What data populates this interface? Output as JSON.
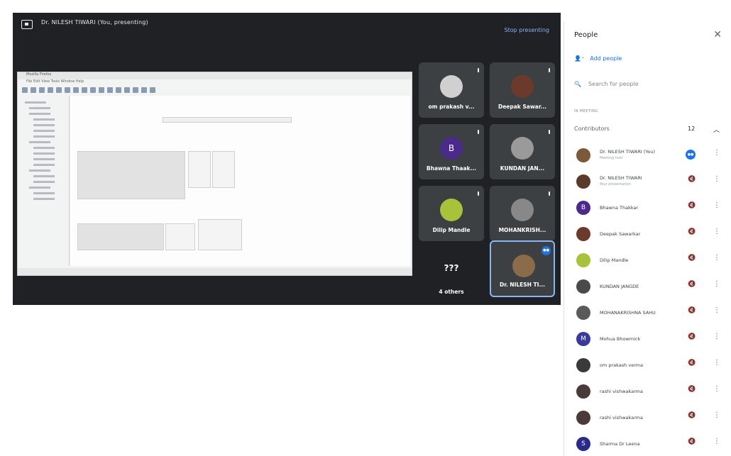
{
  "stage": {
    "presenting_label": "Dr. NILESH TIWARI (You, presenting)",
    "stop_presenting": "Stop presenting",
    "shared_doc": {
      "title": "Mozilla Firefox",
      "menu": "File  Edit  View  Tools  Window  Help"
    }
  },
  "tiles": [
    {
      "name": "om prakash v...",
      "avatar_color": "#d0d0d0"
    },
    {
      "name": "Deepak Sawar...",
      "avatar_color": "#6b3a2a"
    },
    {
      "name": "Bhawna Thaak...",
      "avatar_color": "#4a2a8a",
      "initial": "B"
    },
    {
      "name": "KUNDAN JAN...",
      "avatar_color": "#9a9a9a"
    },
    {
      "name": "Dilip Mandle",
      "avatar_color": "#a8c23a"
    },
    {
      "name": "MOHANKRISH...",
      "avatar_color": "#888888"
    },
    {
      "name": "4 others",
      "icons": "???"
    },
    {
      "name": "Dr. NILESH TI...",
      "avatar_color": "#8a6b4a"
    }
  ],
  "panel": {
    "title": "People",
    "add_people": "Add people",
    "search_placeholder": "Search for people",
    "in_meeting": "IN MEETING",
    "section_label": "Contributors",
    "section_count": "12",
    "people": [
      {
        "name": "Dr. NILESH TIWARI (You)",
        "sub": "Meeting host",
        "avatar_color": "#7a5a3a",
        "status": "badge"
      },
      {
        "name": "Dr. NILESH TIWARI",
        "sub": "Your presentation",
        "avatar_color": "#5a3a2a",
        "status": "mic"
      },
      {
        "name": "Bhawna Thakkar",
        "sub": "",
        "avatar_color": "#4a2a8a",
        "initial": "B",
        "status": "mic"
      },
      {
        "name": "Deepak Sawarkar",
        "sub": "",
        "avatar_color": "#6b3a2a",
        "status": "mic"
      },
      {
        "name": "Dilip Mandle",
        "sub": "",
        "avatar_color": "#a8c23a",
        "status": "mic"
      },
      {
        "name": "KUNDAN JANGDE",
        "sub": "",
        "avatar_color": "#4a4a4a",
        "status": "mic"
      },
      {
        "name": "MOHANAKRISHNA SAHU",
        "sub": "",
        "avatar_color": "#5a5a5a",
        "status": "mic"
      },
      {
        "name": "Mohua Bhowmick",
        "sub": "",
        "avatar_color": "#3a3a9a",
        "initial": "M",
        "status": "mic"
      },
      {
        "name": "om prakash verma",
        "sub": "",
        "avatar_color": "#3a3a3a",
        "status": "mic"
      },
      {
        "name": "rashi vishwakarma",
        "sub": "",
        "avatar_color": "#4a3a3a",
        "status": "mic"
      },
      {
        "name": "rashi vishwakarma",
        "sub": "",
        "avatar_color": "#4a3a3a",
        "status": "mic"
      },
      {
        "name": "Sharma Dr Leena",
        "sub": "",
        "avatar_color": "#2a2a8a",
        "initial": "S",
        "status": "mic"
      }
    ]
  }
}
